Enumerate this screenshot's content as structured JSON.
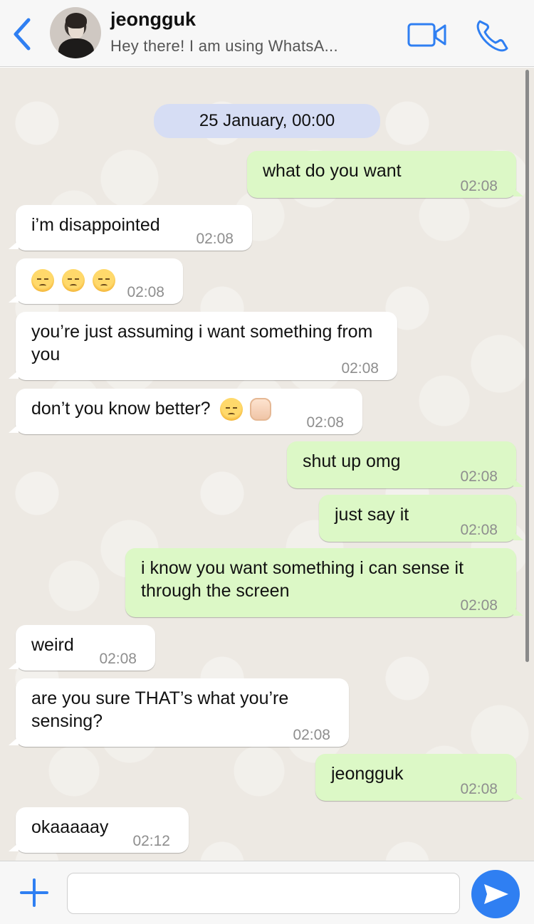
{
  "header": {
    "contact_name": "jeongguk",
    "contact_status": "Hey there! I am using WhatsA...",
    "icons": {
      "back": "chevron-left-icon",
      "video": "video-camera-icon",
      "call": "phone-icon"
    },
    "accent_color": "#2f7ff2"
  },
  "chat": {
    "date_divider": "25 January, 00:00",
    "messages": [
      {
        "dir": "out",
        "text": "what do you want",
        "time": "02:08"
      },
      {
        "dir": "in",
        "text": "i’m disappointed",
        "time": "02:08"
      },
      {
        "dir": "in",
        "text": "",
        "emoji": [
          "pensive-face",
          "pensive-face",
          "pensive-face"
        ],
        "time": "02:08"
      },
      {
        "dir": "in",
        "text": "you’re just assuming i want something from you",
        "time": "02:08"
      },
      {
        "dir": "in",
        "text": "don’t you know better?",
        "emoji": [
          "pensive-face",
          "raised-fist"
        ],
        "time": "02:08"
      },
      {
        "dir": "out",
        "text": "shut up omg",
        "time": "02:08"
      },
      {
        "dir": "out",
        "text": "just say it",
        "time": "02:08"
      },
      {
        "dir": "out",
        "text": "i know you want something i can sense it through the screen",
        "time": "02:08"
      },
      {
        "dir": "in",
        "text": "weird",
        "time": "02:08"
      },
      {
        "dir": "in",
        "text": "are you sure THAT’s what you’re sensing?",
        "time": "02:08"
      },
      {
        "dir": "out",
        "text": "jeongguk",
        "time": "02:08"
      },
      {
        "dir": "in",
        "text": "okaaaaay",
        "time": "02:12"
      }
    ]
  },
  "composer": {
    "input_value": "",
    "icons": {
      "attach": "plus-icon",
      "send": "send-arrow-icon"
    }
  },
  "colors": {
    "incoming_bubble": "#ffffff",
    "outgoing_bubble": "#dcf8c6",
    "date_pill": "#d6ddf4"
  }
}
